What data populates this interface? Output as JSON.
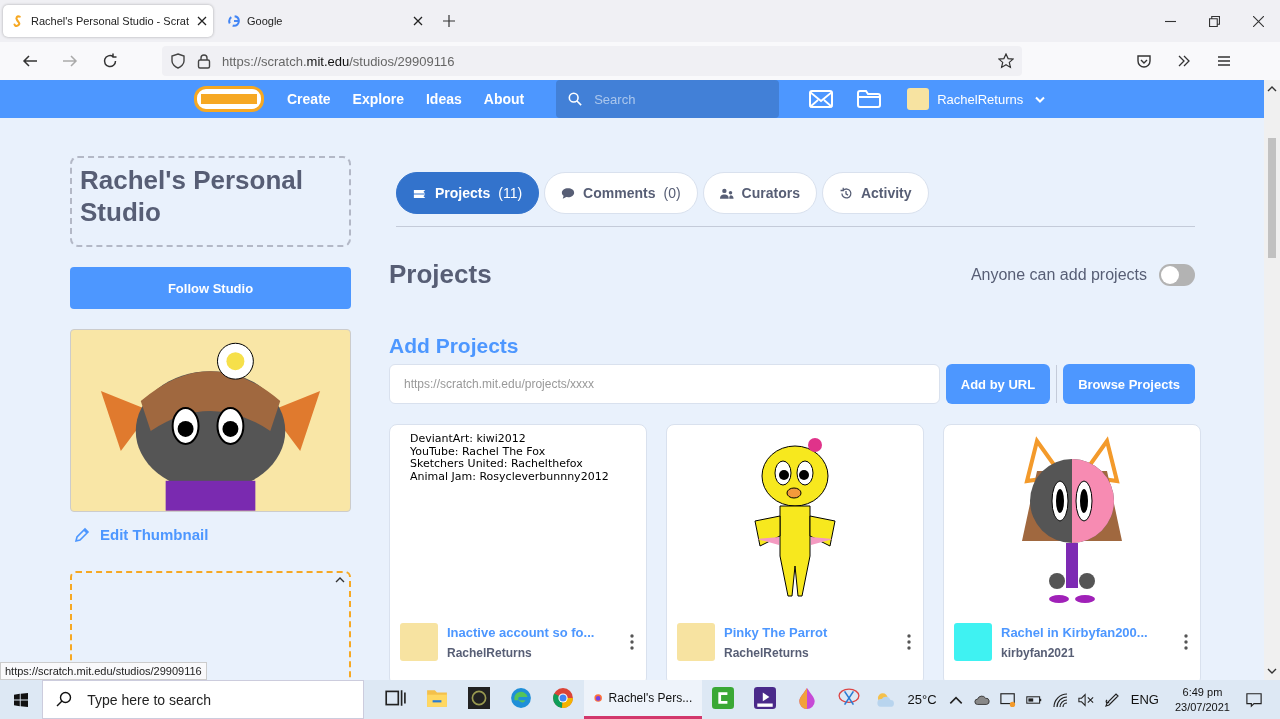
{
  "browser": {
    "tabs": [
      {
        "title": "Rachel's Personal Studio - Scrat",
        "selected": true,
        "kind": "scratch"
      },
      {
        "title": "Google",
        "selected": false,
        "kind": "google"
      }
    ],
    "url_host": "https://scratch.",
    "url_domain": "mit.edu",
    "url_path": "/studios/29909116",
    "status_url": "https://scratch.mit.edu/studios/29909116"
  },
  "nav": {
    "items": [
      "Create",
      "Explore",
      "Ideas",
      "About"
    ],
    "search_placeholder": "Search",
    "username": "RachelReturns"
  },
  "studio": {
    "title": "Rachel's Personal Studio",
    "follow_button": "Follow Studio",
    "edit_thumbnail": "Edit Thumbnail"
  },
  "tabs": [
    {
      "label": "Projects",
      "count": "(11)",
      "selected": true,
      "kind": "projects"
    },
    {
      "label": "Comments",
      "count": "(0)",
      "selected": false,
      "kind": "comments"
    },
    {
      "label": "Curators",
      "selected": false,
      "kind": "curators"
    },
    {
      "label": "Activity",
      "selected": false,
      "kind": "activity"
    }
  ],
  "projects": {
    "heading": "Projects",
    "toggle_label": "Anyone can add projects",
    "anyone_can_add": false,
    "add_heading": "Add Projects",
    "url_placeholder": "https://scratch.mit.edu/projects/xxxx",
    "buttons": [
      "Add by URL",
      "Browse Projects"
    ],
    "cards": [
      {
        "kind": "text",
        "lines": [
          "DeviantArt: kiwi2012",
          "YouTube: Rachel The Fox",
          "Sketchers United: Rachelthefox",
          "Animal Jam: Rosycleverbunnny2012"
        ],
        "title": "Inactive account so fo...",
        "author": "RachelReturns",
        "color": "#f7e3a1"
      },
      {
        "kind": "bird",
        "title": "Pinky The Parrot",
        "author": "RachelReturns",
        "color": "#f7e3a1"
      },
      {
        "kind": "cat",
        "title": "Rachel in Kirbyfan200...",
        "author": "kirbyfan2021",
        "color": "#3ff2f2"
      }
    ]
  },
  "taskbar": {
    "search_placeholder": "Type here to search",
    "apps": [
      {
        "kind": "taskview",
        "selected": false
      },
      {
        "kind": "folder",
        "selected": false
      },
      {
        "kind": "dark",
        "selected": false
      },
      {
        "kind": "edge",
        "selected": false
      },
      {
        "kind": "chrome",
        "selected": false
      },
      {
        "kind": "firefox",
        "label": "Rachel's Pers...",
        "selected": true
      },
      {
        "kind": "green",
        "selected": false
      },
      {
        "kind": "video",
        "selected": false
      },
      {
        "kind": "drop",
        "selected": false
      },
      {
        "kind": "snip",
        "selected": false
      }
    ],
    "weather": "25°C",
    "language": "ENG",
    "time": "6:49 pm",
    "date": "23/07/2021"
  }
}
